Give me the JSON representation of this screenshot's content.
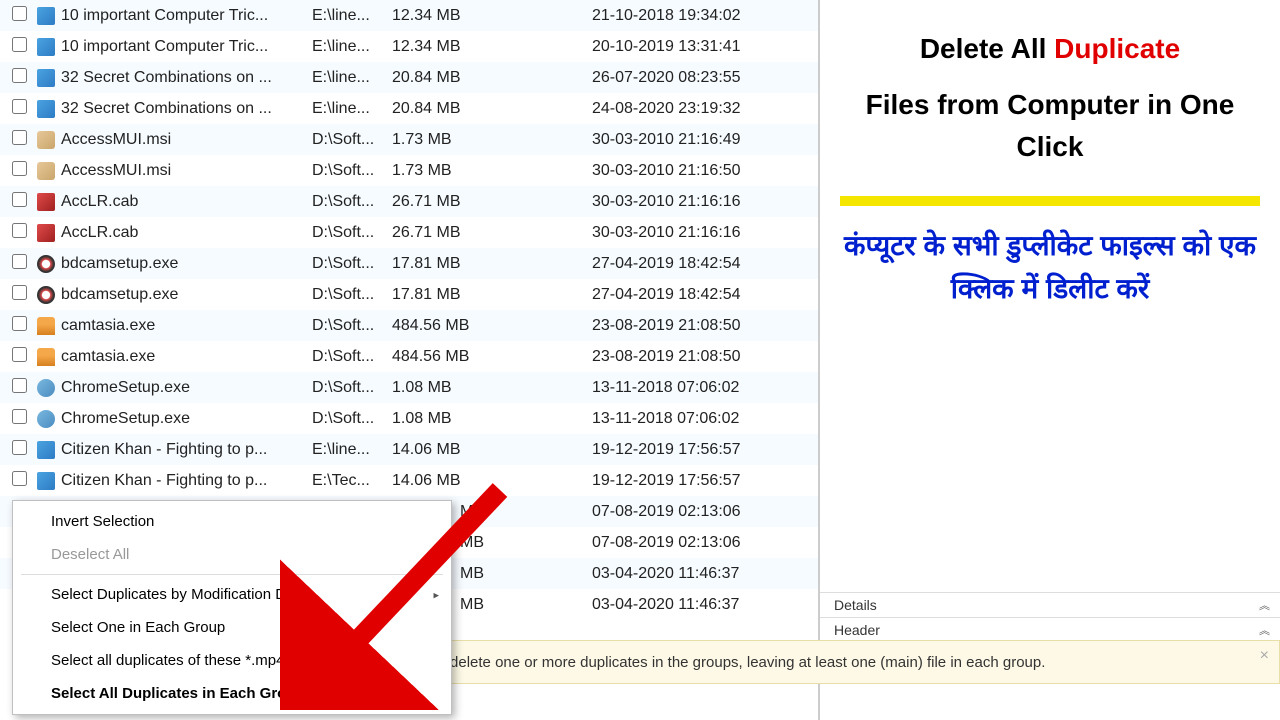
{
  "files": [
    {
      "name": "10 important Computer Tric...",
      "path": "E:\\line...",
      "size": "12.34 MB",
      "date": "21-10-2018 19:34:02",
      "icon": "icon-video",
      "alt": true
    },
    {
      "name": "10 important Computer Tric...",
      "path": "E:\\line...",
      "size": "12.34 MB",
      "date": "20-10-2019 13:31:41",
      "icon": "icon-video",
      "alt": false
    },
    {
      "name": "32 Secret Combinations on ...",
      "path": "E:\\line...",
      "size": "20.84 MB",
      "date": "26-07-2020 08:23:55",
      "icon": "icon-video",
      "alt": true
    },
    {
      "name": "32 Secret Combinations on ...",
      "path": "E:\\line...",
      "size": "20.84 MB",
      "date": "24-08-2020 23:19:32",
      "icon": "icon-video",
      "alt": false
    },
    {
      "name": "AccessMUI.msi",
      "path": "D:\\Soft...",
      "size": "1.73 MB",
      "date": "30-03-2010 21:16:49",
      "icon": "icon-msi",
      "alt": true
    },
    {
      "name": "AccessMUI.msi",
      "path": "D:\\Soft...",
      "size": "1.73 MB",
      "date": "30-03-2010 21:16:50",
      "icon": "icon-msi",
      "alt": false
    },
    {
      "name": "AccLR.cab",
      "path": "D:\\Soft...",
      "size": "26.71 MB",
      "date": "30-03-2010 21:16:16",
      "icon": "icon-cab",
      "alt": true
    },
    {
      "name": "AccLR.cab",
      "path": "D:\\Soft...",
      "size": "26.71 MB",
      "date": "30-03-2010 21:16:16",
      "icon": "icon-cab",
      "alt": false
    },
    {
      "name": "bdcamsetup.exe",
      "path": "D:\\Soft...",
      "size": "17.81 MB",
      "date": "27-04-2019 18:42:54",
      "icon": "icon-exe1",
      "alt": true
    },
    {
      "name": "bdcamsetup.exe",
      "path": "D:\\Soft...",
      "size": "17.81 MB",
      "date": "27-04-2019 18:42:54",
      "icon": "icon-exe1",
      "alt": false
    },
    {
      "name": "camtasia.exe",
      "path": "D:\\Soft...",
      "size": "484.56 MB",
      "date": "23-08-2019 21:08:50",
      "icon": "icon-exe2",
      "alt": true
    },
    {
      "name": "camtasia.exe",
      "path": "D:\\Soft...",
      "size": "484.56 MB",
      "date": "23-08-2019 21:08:50",
      "icon": "icon-exe2",
      "alt": false
    },
    {
      "name": "ChromeSetup.exe",
      "path": "D:\\Soft...",
      "size": "1.08 MB",
      "date": "13-11-2018 07:06:02",
      "icon": "icon-exe3",
      "alt": true
    },
    {
      "name": "ChromeSetup.exe",
      "path": "D:\\Soft...",
      "size": "1.08 MB",
      "date": "13-11-2018 07:06:02",
      "icon": "icon-exe3",
      "alt": false
    },
    {
      "name": "Citizen Khan - Fighting to p...",
      "path": "E:\\line...",
      "size": "14.06 MB",
      "date": "19-12-2019 17:56:57",
      "icon": "icon-video",
      "alt": true
    },
    {
      "name": "Citizen Khan - Fighting to p...",
      "path": "E:\\Tec...",
      "size": "14.06 MB",
      "date": "19-12-2019 17:56:57",
      "icon": "icon-video",
      "alt": false
    }
  ],
  "hidden_rows": [
    {
      "size": "MB",
      "date": "07-08-2019 02:13:06"
    },
    {
      "size": "MB",
      "date": "07-08-2019 02:13:06"
    },
    {
      "size": "MB",
      "date": "03-04-2020 11:46:37"
    },
    {
      "size": "MB",
      "date": "03-04-2020 11:46:37"
    }
  ],
  "context_menu": {
    "invert": "Invert Selection",
    "deselect": "Deselect All",
    "by_date": "Select Duplicates by Modification Date",
    "one_each": "Select One in Each Group",
    "all_ext": "Select all duplicates of these *.mp4 file",
    "all_dup": "Select All Duplicates in Each Group"
  },
  "banner": {
    "text": "ct and delete one or more duplicates in the groups, leaving at least one (main) file in each group.",
    "close": "×"
  },
  "side": {
    "title_pre": "Delete All ",
    "title_red": "Duplicate",
    "title_line2": "Files from Computer in One Click",
    "hindi": "कंप्यूटर के सभी डुप्लीकेट फाइल्स को एक क्लिक में डिलीट करें",
    "tab_details": "Details",
    "tab_header": "Header"
  }
}
